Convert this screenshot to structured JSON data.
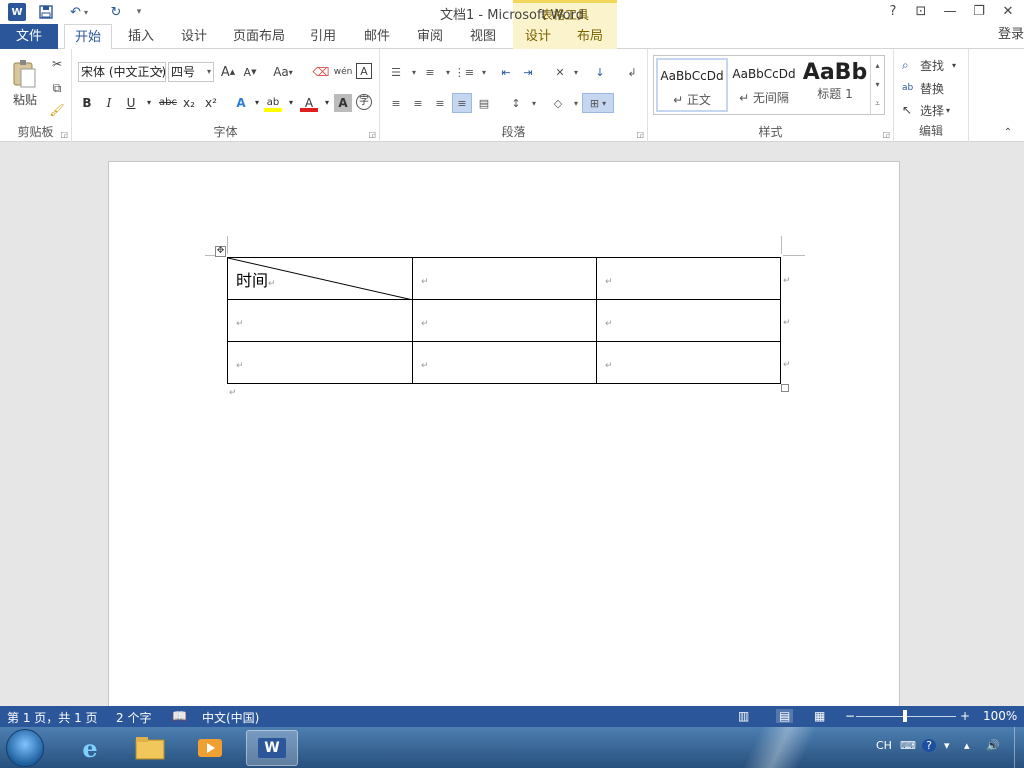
{
  "window": {
    "title": "文档1 - Microsoft Word",
    "contextual_group": "表格工具",
    "help": "?",
    "signin": "登录",
    "app_icon": "W",
    "buttons": {
      "help": "?",
      "ribbon_display": "⊡",
      "minimize": "—",
      "restore": "❐",
      "close": "✕"
    }
  },
  "tabs": {
    "file": "文件",
    "items": [
      "开始",
      "插入",
      "设计",
      "页面布局",
      "引用",
      "邮件",
      "审阅",
      "视图"
    ],
    "context_items": [
      "设计",
      "布局"
    ],
    "active": "开始"
  },
  "ribbon": {
    "clipboard": {
      "paste": "粘贴",
      "label": "剪贴板"
    },
    "font": {
      "font_name": "宋体 (中文正文)",
      "font_size": "四号",
      "label": "字体",
      "bold": "B",
      "italic": "I",
      "underline": "U",
      "strike": "abc",
      "subscript": "x₂",
      "superscript": "x²",
      "grow": "A",
      "shrink": "A",
      "case": "Aa",
      "phonetic": "wén",
      "border_char": "A"
    },
    "paragraph": {
      "label": "段落"
    },
    "styles": {
      "label": "样式",
      "items": [
        {
          "sample": "AaBbCcDd",
          "name": "↵ 正文"
        },
        {
          "sample": "AaBbCcDd",
          "name": "↵ 无间隔"
        },
        {
          "sample": "AaBb",
          "name": "标题 1"
        }
      ]
    },
    "editing": {
      "label": "编辑",
      "find": "查找",
      "replace": "替换",
      "select": "选择"
    }
  },
  "document": {
    "table": [
      [
        "时间",
        "",
        ""
      ],
      [
        "",
        "",
        ""
      ],
      [
        "",
        "",
        ""
      ]
    ],
    "para_mark": "↵"
  },
  "status": {
    "page": "第 1 页，共 1 页",
    "words": "2 个字",
    "language": "中文(中国)",
    "zoom": "100%",
    "zoom_percent": 100
  },
  "taskbar": {
    "items": [
      "internet-explorer",
      "file-explorer",
      "media-player",
      "word"
    ],
    "input": "CH"
  }
}
